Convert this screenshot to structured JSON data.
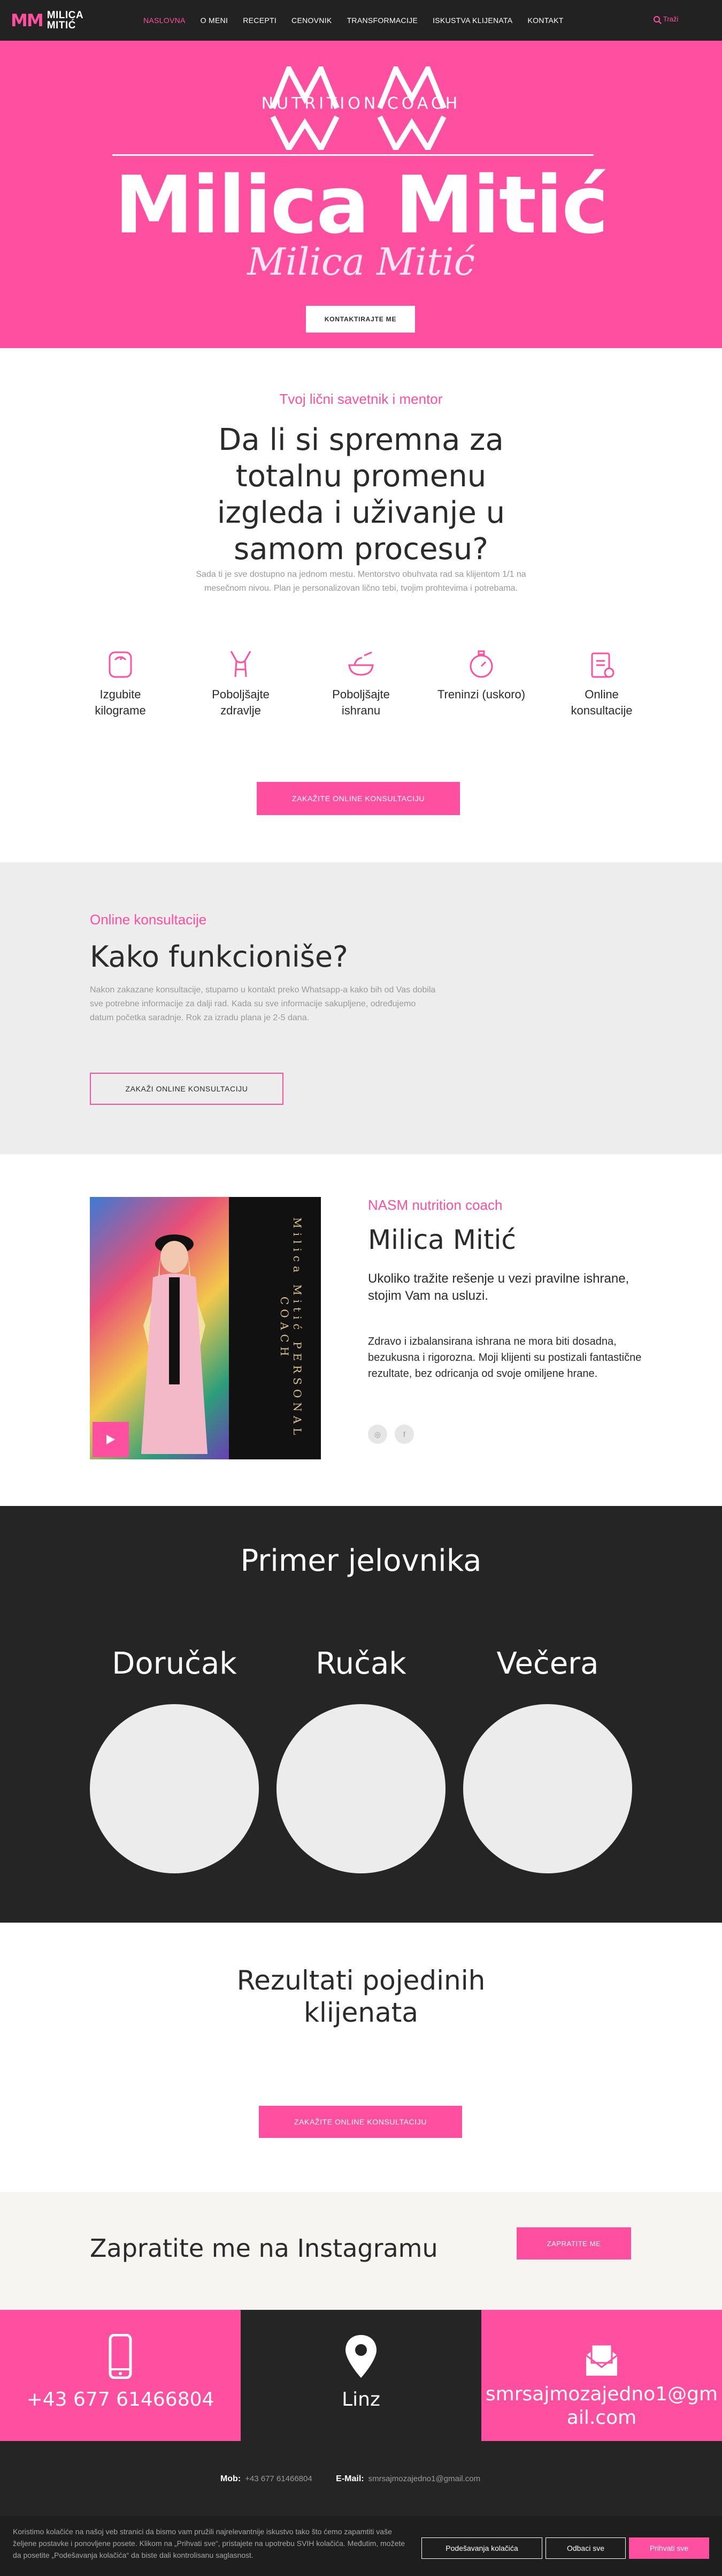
{
  "nav": {
    "logo_mark": "MM",
    "logo_line1": "MILICA",
    "logo_line2": "MITIĆ",
    "items": [
      {
        "label": "NASLOVNA",
        "active": true
      },
      {
        "label": "O MENI"
      },
      {
        "label": "RECEPTI"
      },
      {
        "label": "CENOVNIK"
      },
      {
        "label": "TRANSFORMACIJE"
      },
      {
        "label": "ISKUSTVA KLIJENATA"
      },
      {
        "label": "KONTAKT"
      }
    ],
    "search_placeholder": "Traži"
  },
  "hero": {
    "subtitle": "NUTRITION COACH",
    "name": "Milica Mitić",
    "signature": "Milica Mitić",
    "button": "KONTAKTIRAJTE ME"
  },
  "intro": {
    "subtitle": "Tvoj lični savetnik i mentor",
    "title": "Da li si spremna za totalnu promenu izgleda i uživanje u samom procesu?",
    "text": "Sada ti je sve dostupno na jednom mestu. Mentorstvo obuhvata rad sa klijentom 1/1 na mesečnom nivou. Plan je personalizovan lično tebi, tvojim prohtevima i potrebama.",
    "features": [
      {
        "icon": "scale-icon",
        "label": "Izgubite kilograme"
      },
      {
        "icon": "body-icon",
        "label": "Poboljšajte zdravlje"
      },
      {
        "icon": "food-bowl-icon",
        "label": "Poboljšajte ishranu"
      },
      {
        "icon": "stopwatch-icon",
        "label": "Treninzi (uskoro)"
      },
      {
        "icon": "clipboard-icon",
        "label": "Online konsultacije"
      }
    ],
    "button": "ZAKAŽITE ONLINE KONSULTACIJU"
  },
  "how": {
    "subtitle": "Online konsultacije",
    "title": "Kako funkcioniše?",
    "text": "Nakon zakazane konsultacije, stupamo u kontakt preko Whatsapp-a kako bih od Vas dobila sve potrebne informacije za dalji rad. Kada su sve informacije sakupljene, određujemo datum početka saradnje. Rok za izradu plana je 2-5 dana.",
    "button": "ZAKAŽI ONLINE KONSULTACIJU"
  },
  "coach": {
    "photo_text": "Milica Mitić PERSONAL COACH",
    "subtitle": "NASM nutrition coach",
    "name": "Milica Mitić",
    "lead": "Ukoliko tražite rešenje u vezi pravilne ishrane, stojim Vam na usluzi.",
    "text": "Zdravo i izbalansirana ishrana ne mora biti dosadna, bezukusna i rigorozna. Moji klijenti su postizali fantastične rezultate, bez odricanja od svoje omiljene hrane.",
    "social": [
      "instagram-icon",
      "facebook-icon"
    ]
  },
  "menu": {
    "title": "Primer jelovnika",
    "meals": [
      "Doručak",
      "Ručak",
      "Večera"
    ]
  },
  "results": {
    "title": "Rezultati pojedinih klijenata",
    "button": "ZAKAŽITE ONLINE KONSULTACIJU"
  },
  "instagram": {
    "title": "Zapratite me na Instagramu",
    "button": "ZAPRATITE ME"
  },
  "contacts": [
    {
      "icon": "phone-icon",
      "text": "+43 677 61466804"
    },
    {
      "icon": "location-pin-icon",
      "text": "Linz"
    },
    {
      "icon": "email-icon",
      "text": "smrsajmozajedno1@gmail.com"
    }
  ],
  "footer": {
    "mob_label": "Mob:",
    "mob_value": "+43 677 61466804",
    "email_label": "E-Mail:",
    "email_value": "smrsajmozajedno1@gmail.com"
  },
  "cookie": {
    "text": "Koristimo kolačiće na našoj veb stranici da bismo vam pružili najrelevantnije iskustvo tako što ćemo zapamtiti vaše željene postavke i ponovljene posete. Klikom na „Prihvati sve“, pristajete na upotrebu SVIH kolačića. Međutim, možete da posetite „Podešavanja kolačića“ da biste dali kontrolisanu saglasnost.",
    "settings": "Podešavanja kolačića",
    "reject": "Odbaci sve",
    "accept": "Prihvati sve"
  },
  "colors": {
    "accent": "#ff4fa1",
    "dark": "#252525",
    "light_gray": "#ededed"
  }
}
